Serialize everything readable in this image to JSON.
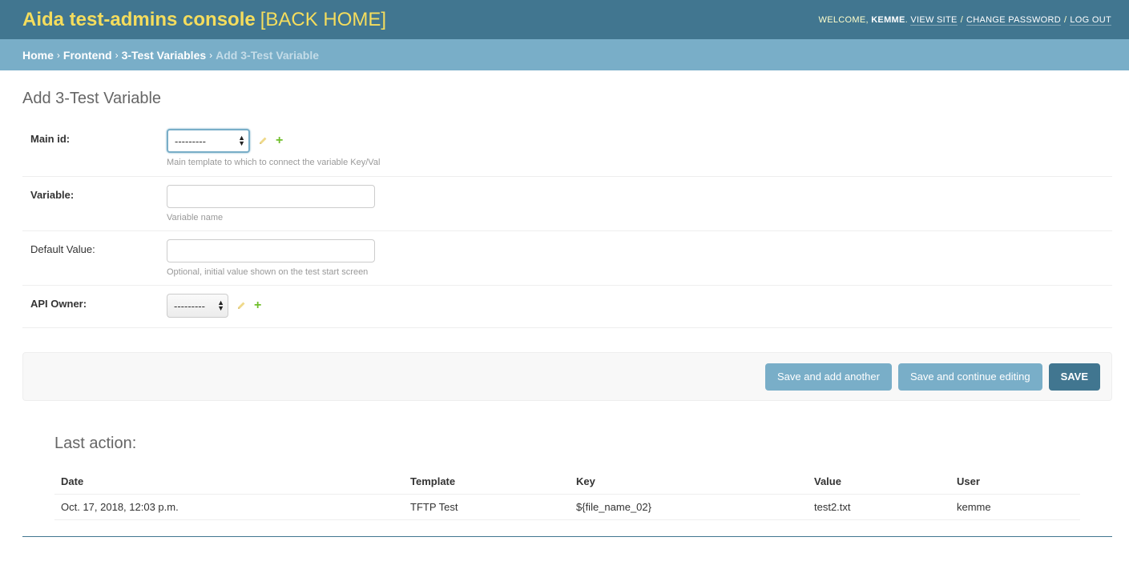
{
  "header": {
    "site_name": "Aida test-admins console",
    "back_home": "[BACK HOME]",
    "welcome": "WELCOME,",
    "username": "KEMME",
    "view_site": "VIEW SITE",
    "change_password": "CHANGE PASSWORD",
    "logout": "LOG OUT",
    "sep": "/"
  },
  "breadcrumbs": {
    "home": "Home",
    "app": "Frontend",
    "model": "3-Test Variables",
    "current": "Add 3-Test Variable",
    "arrow": "›"
  },
  "page_title": "Add 3-Test Variable",
  "form": {
    "main_id": {
      "label": "Main id:",
      "value": "---------",
      "help": "Main template to which to connect the variable Key/Val"
    },
    "variable": {
      "label": "Variable:",
      "value": "",
      "help": "Variable name"
    },
    "default_value": {
      "label": "Default Value:",
      "value": "",
      "help": "Optional, initial value shown on the test start screen"
    },
    "api_owner": {
      "label": "API Owner:",
      "value": "---------"
    }
  },
  "buttons": {
    "save_add_another": "Save and add another",
    "save_continue": "Save and continue editing",
    "save": "SAVE"
  },
  "last_action": {
    "title": "Last action:",
    "columns": [
      "Date",
      "Template",
      "Key",
      "Value",
      "User"
    ],
    "rows": [
      [
        "Oct. 17, 2018, 12:03 p.m.",
        "TFTP Test",
        "${file_name_02}",
        "test2.txt",
        "kemme"
      ]
    ]
  },
  "colors": {
    "header_bg": "#417690",
    "breadcrumb_bg": "#79aec8",
    "brand_yellow": "#f5dd5d",
    "add_green": "#70bf2b"
  }
}
